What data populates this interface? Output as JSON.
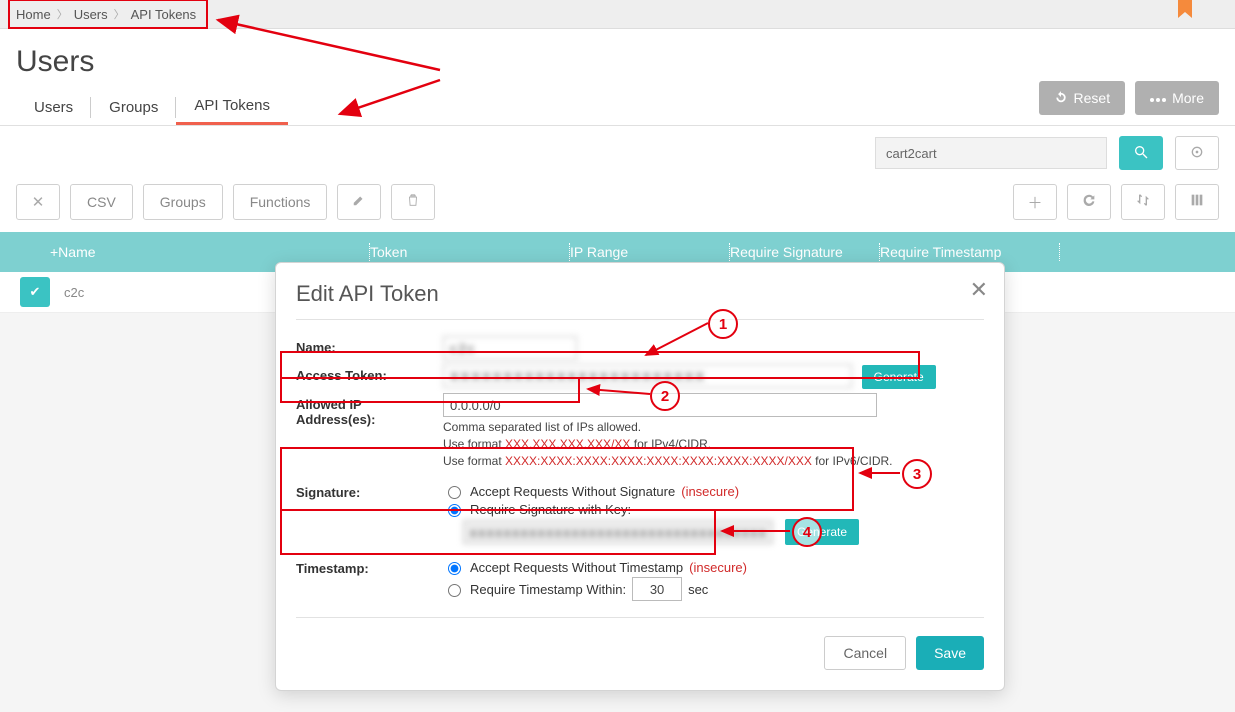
{
  "breadcrumbs": {
    "home": "Home",
    "users": "Users",
    "api": "API Tokens"
  },
  "page": {
    "title": "Users"
  },
  "tabs": {
    "users": "Users",
    "groups": "Groups",
    "api": "API Tokens"
  },
  "buttons": {
    "reset": "Reset",
    "more": "More",
    "csv": "CSV",
    "groups": "Groups",
    "functions": "Functions"
  },
  "search": {
    "value": "cart2cart"
  },
  "table": {
    "cols": {
      "name": "+Name",
      "token": "Token",
      "ip": "IP Range",
      "sig": "Require Signature",
      "ts": "Require Timestamp"
    },
    "rows": [
      {
        "name": "c2c"
      }
    ]
  },
  "modal": {
    "title": "Edit API Token",
    "labels": {
      "name": "Name:",
      "access_token": "Access Token:",
      "allowed_ip": "Allowed IP Address(es):",
      "signature": "Signature:",
      "timestamp": "Timestamp:"
    },
    "name_value": "c2c",
    "token_value": "XXXXXXXXXXXXXXXXXXXXXXXX",
    "ip_value": "0.0.0.0/0",
    "hint": {
      "line1": "Comma separated list of IPs allowed.",
      "line2a": "Use format ",
      "line2fmt": "XXX.XXX.XXX.XXX/XX",
      "line2b": " for IPv4/CIDR.",
      "line3a": "Use format ",
      "line3fmt": "XXXX:XXXX:XXXX:XXXX:XXXX:XXXX:XXXX:XXXX/XXX",
      "line3b": " for IPv6/CIDR."
    },
    "sig": {
      "opt1a": "Accept Requests Without Signature ",
      "insecure": "(insecure)",
      "opt2": "Require Signature with Key:",
      "key_value": "xxxxxxxxxxxxxxxxxxxxxxxxxxxxxxxxxxxxxxxxxxxx"
    },
    "ts": {
      "opt1a": "Accept Requests Without Timestamp ",
      "opt2a": "Require Timestamp Within: ",
      "sec_value": "30",
      "sec_unit": " sec"
    },
    "generate": "Generate",
    "cancel": "Cancel",
    "save": "Save"
  },
  "annot": {
    "n1": "1",
    "n2": "2",
    "n3": "3",
    "n4": "4"
  }
}
